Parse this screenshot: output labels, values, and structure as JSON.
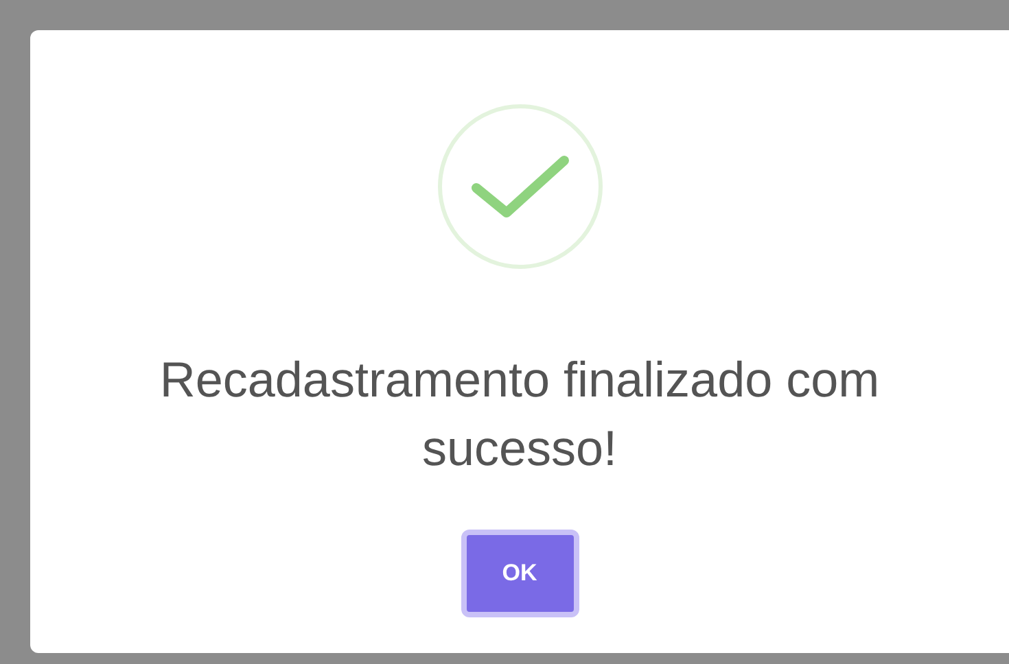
{
  "dialog": {
    "icon": {
      "kind": "success"
    },
    "title": "Recadastramento finalizado com sucesso!",
    "buttons": [
      {
        "label": "OK"
      }
    ]
  }
}
